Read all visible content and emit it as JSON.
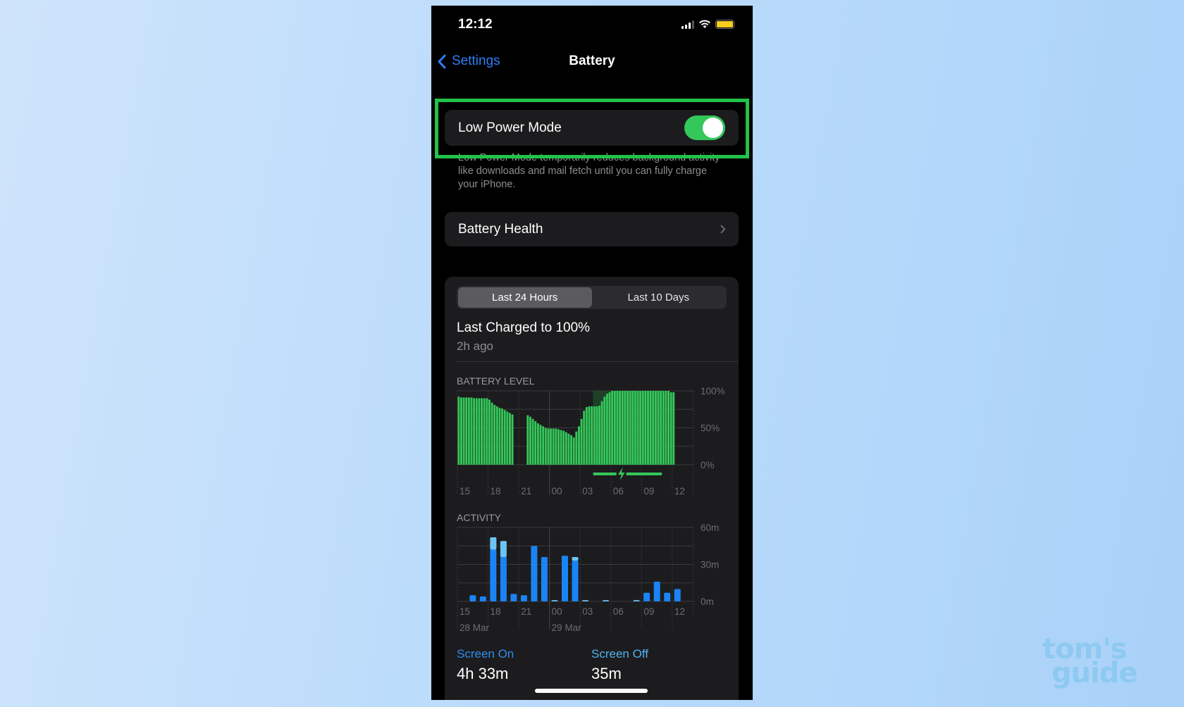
{
  "status": {
    "time": "12:12",
    "battery_color": "#f7ce1d"
  },
  "nav": {
    "back_label": "Settings",
    "title": "Battery"
  },
  "low_power": {
    "label": "Low Power Mode",
    "enabled": true,
    "description": "Low Power Mode temporarily reduces background activity like downloads and mail fetch until you can fully charge your iPhone."
  },
  "battery_health": {
    "label": "Battery Health"
  },
  "tabs": [
    {
      "label": "Last 24 Hours",
      "selected": true
    },
    {
      "label": "Last 10 Days",
      "selected": false
    }
  ],
  "last_charged": {
    "title": "Last Charged to 100%",
    "ago": "2h ago"
  },
  "chart_data": [
    {
      "type": "bar",
      "title": "BATTERY LEVEL",
      "x_ticks": [
        "15",
        "18",
        "21",
        "00",
        "03",
        "06",
        "09",
        "12"
      ],
      "y_ticks": [
        "100%",
        "50%",
        "0%"
      ],
      "ylim": [
        0,
        100
      ],
      "interval": "15 min",
      "start": "15:00",
      "charging": {
        "from": "02:15",
        "to": "09:00"
      },
      "color": "#34c759",
      "values": [
        92,
        91,
        91,
        91,
        91,
        91,
        90,
        90,
        90,
        90,
        90,
        90,
        88,
        84,
        81,
        79,
        77,
        76,
        74,
        72,
        70,
        68,
        null,
        null,
        null,
        null,
        null,
        67,
        65,
        62,
        59,
        56,
        54,
        52,
        50,
        49,
        49,
        49,
        49,
        48,
        47,
        46,
        44,
        42,
        40,
        37,
        45,
        52,
        62,
        73,
        78,
        79,
        79,
        79,
        79,
        80,
        86,
        92,
        96,
        98,
        100,
        100,
        100,
        100,
        100,
        100,
        100,
        100,
        100,
        100,
        100,
        100,
        100,
        100,
        100,
        100,
        100,
        100,
        100,
        100,
        100,
        100,
        100,
        98,
        98
      ]
    },
    {
      "type": "bar",
      "title": "ACTIVITY",
      "x_ticks": [
        "15",
        "18",
        "21",
        "00",
        "03",
        "06",
        "09",
        "12"
      ],
      "date_labels": [
        "28 Mar",
        "29 Mar"
      ],
      "y_ticks": [
        "60m",
        "30m",
        "0m"
      ],
      "ylim": [
        0,
        60
      ],
      "interval": "1 hour",
      "start": "15:00",
      "colors": {
        "screen_on": "#1a84f5",
        "screen_off": "#6cc4f5"
      },
      "series": [
        {
          "name": "Screen On",
          "values": [
            0,
            5,
            4,
            42,
            36,
            6,
            5,
            45,
            36,
            0,
            37,
            33,
            0,
            0,
            0,
            0,
            0,
            0,
            7,
            16,
            7,
            10
          ]
        },
        {
          "name": "Screen Off",
          "values": [
            0,
            0,
            0,
            10,
            13,
            0,
            0,
            0,
            0,
            1,
            0,
            3,
            1,
            0,
            1,
            0,
            0,
            1,
            0,
            0,
            0,
            0
          ]
        }
      ]
    }
  ],
  "summary": {
    "screen_on_label": "Screen On",
    "screen_on_value": "4h 33m",
    "screen_off_label": "Screen Off",
    "screen_off_value": "35m"
  },
  "watermark": {
    "text": "tom's guide"
  }
}
